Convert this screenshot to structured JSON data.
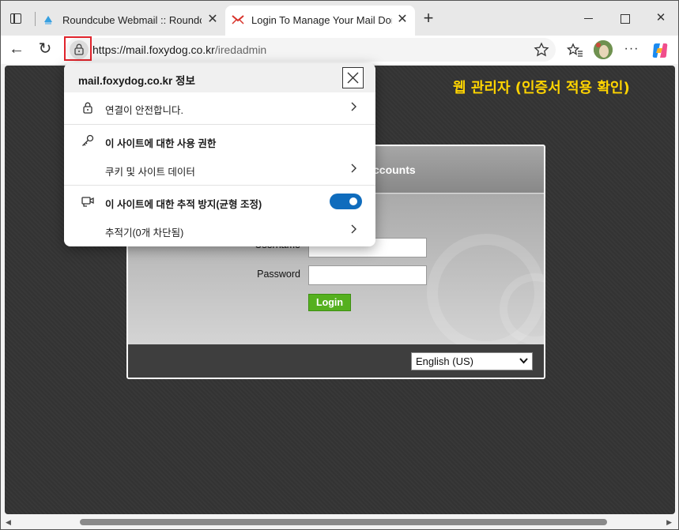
{
  "browser": {
    "tabs": [
      {
        "title": "Roundcube Webmail :: Roundcube",
        "close": "✕",
        "favicon": "roundcube-cloud-icon"
      },
      {
        "title": "Login To Manage Your Mail Domains",
        "close": "✕",
        "favicon": "iredadmin-mail-icon"
      }
    ],
    "new_tab": "+",
    "window_close": "✕",
    "back": "←",
    "reload": "↻",
    "url_host": "https://mail.foxydog.co.kr",
    "url_path": "/iredadmin",
    "more": "···"
  },
  "site_info": {
    "title": "mail.foxydog.co.kr 정보",
    "connection": "연결이 안전합니다.",
    "permissions": "이 사이트에 대한 사용 권한",
    "cookies": "쿠키 및 사이트 데이터",
    "tracking": "이 사이트에 대한 추적 방지(균형 조정)",
    "tracking_enabled": true,
    "trackers": "추적기(0개 차단됨)"
  },
  "page": {
    "caption": "웹 관리자 (인증서 적용 확인)",
    "header_fragment": "ccounts",
    "username_label": "Username",
    "password_label": "Password",
    "login_button": "Login",
    "language": "English (US)"
  },
  "colors": {
    "caption": "#ffd400",
    "login_button": "#55b01f",
    "toggle": "#0f6cbd",
    "highlight": "#e0232b"
  }
}
